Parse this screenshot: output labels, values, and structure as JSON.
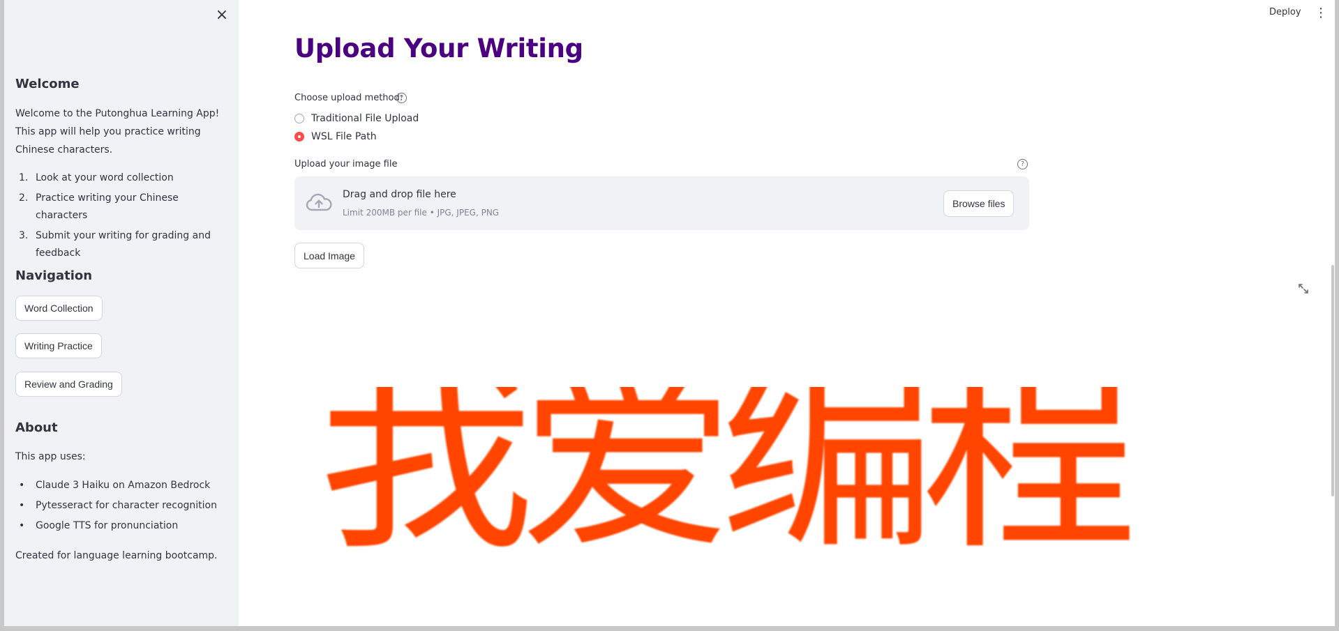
{
  "sidebar": {
    "close_glyph": "×",
    "welcome": {
      "heading": "Welcome",
      "intro_line1": "Welcome to the Putonghua Learning App!",
      "intro_line2": "This app will help you practice writing",
      "intro_line3": "Chinese characters.",
      "steps": [
        {
          "num": "1.",
          "text": "Look at your word collection"
        },
        {
          "num": "2.",
          "text": "Practice writing your Chinese characters"
        },
        {
          "num": "3.",
          "text_line1": "Submit your writing for grading and",
          "text_line2": "feedback"
        }
      ]
    },
    "navigation": {
      "heading": "Navigation",
      "buttons": [
        "Word Collection",
        "Writing Practice",
        "Review and Grading"
      ]
    },
    "about": {
      "heading": "About",
      "intro": "This app uses:",
      "items": [
        "Claude 3 Haiku on Amazon Bedrock",
        "Pytesseract for character recognition",
        "Google TTS for pronunciation"
      ],
      "footer": "Created for language learning bootcamp."
    }
  },
  "header": {
    "deploy_label": "Deploy",
    "menu_glyph": "⋮"
  },
  "main": {
    "title": "Upload Your Writing",
    "upload_method": {
      "label": "Choose upload method:",
      "help_glyph": "?",
      "options": [
        {
          "label": "Traditional File Upload",
          "checked": false
        },
        {
          "label": "WSL File Path",
          "checked": true
        }
      ]
    },
    "uploader": {
      "label": "Upload your image file",
      "help_glyph": "?",
      "drop_title": "Drag and drop file here",
      "drop_limit": "Limit 200MB per file • JPG, JPEG, PNG",
      "browse_label": "Browse files"
    },
    "load_button": "Load Image",
    "image_text": "我爱编程"
  },
  "colors": {
    "title": "#4b0082",
    "radio_accent": "#ff4b4b",
    "image_text": "#ff4500",
    "sidebar_bg": "#f0f2f6"
  }
}
